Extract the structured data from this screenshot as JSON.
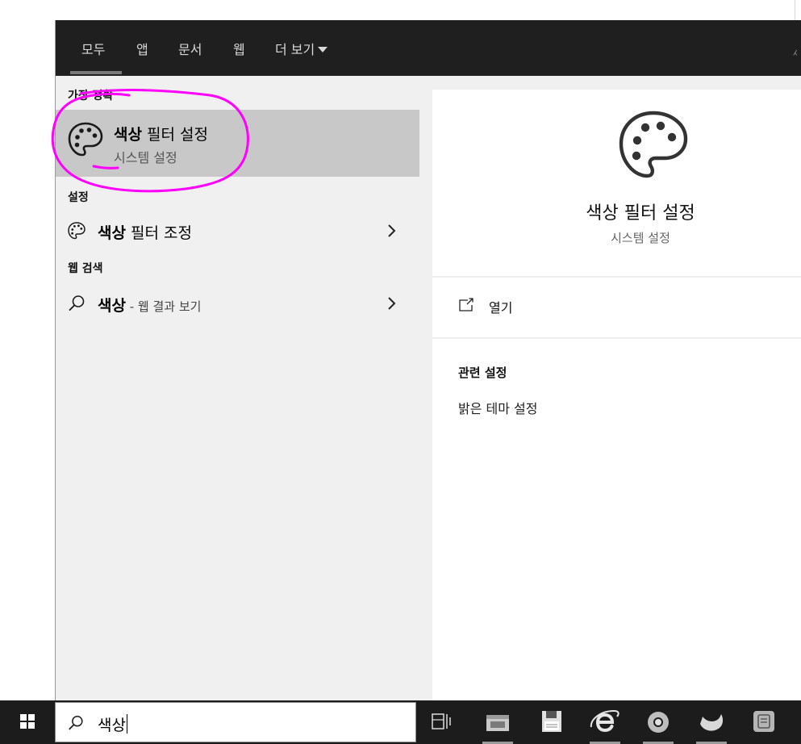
{
  "tabs": [
    {
      "label": "모두",
      "active": true
    },
    {
      "label": "앱"
    },
    {
      "label": "문서"
    },
    {
      "label": "웹"
    },
    {
      "label": "더 보기"
    }
  ],
  "groups": {
    "best_match": "가장 정확",
    "settings": "설정",
    "web_search": "웹 검색"
  },
  "best_match": {
    "title_bold": "색상",
    "title_rest": " 필터 설정",
    "subtitle": "시스템 설정",
    "icon": "palette-icon"
  },
  "settings_item": {
    "title_bold": "색상",
    "title_rest": " 필터 조정",
    "icon": "palette-icon"
  },
  "web_item": {
    "title_bold": "색상",
    "suffix": " - 웹 결과 보기",
    "icon": "search-icon"
  },
  "preview": {
    "title": "색상 필터 설정",
    "subtitle": "시스템 설정",
    "open_label": "열기",
    "related_header": "관련 설정",
    "related_link": "밝은 테마 설정"
  },
  "search": {
    "query": "색상"
  },
  "colors": {
    "annotation": "#ff00ff",
    "topbar": "#1f1f1f",
    "selected": "#c8c8c8"
  }
}
